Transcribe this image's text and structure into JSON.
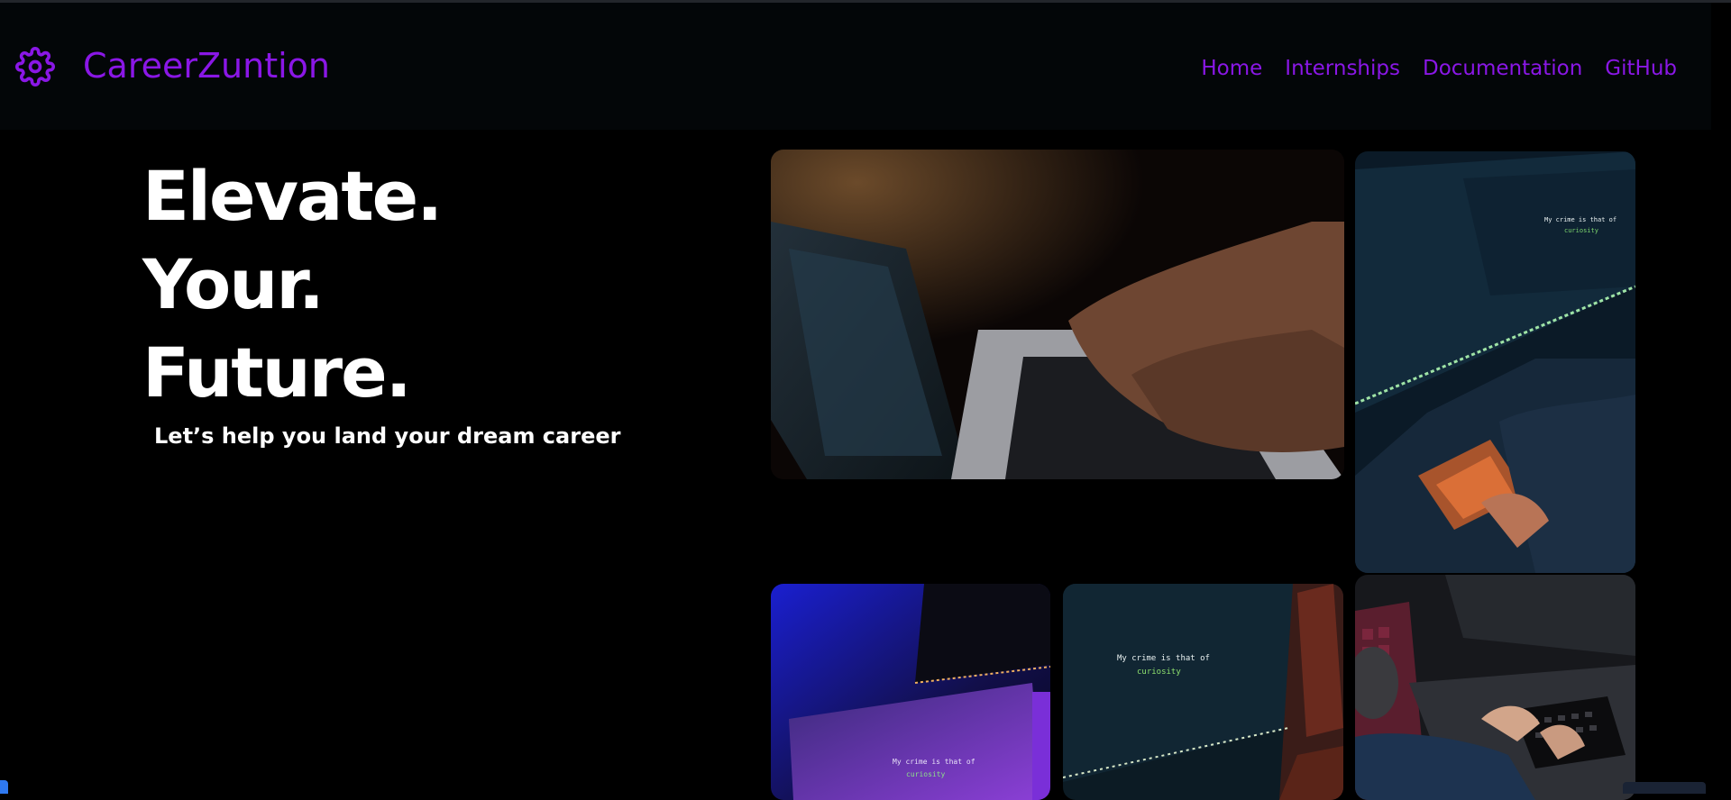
{
  "navbar": {
    "brand_icon": "gear-icon",
    "brand_name": "CareerZuntion",
    "links": [
      "Home",
      "Internships",
      "Documentation",
      "GitHub"
    ]
  },
  "hero": {
    "lines": [
      "Elevate.",
      "Your.",
      "Future."
    ],
    "subtitle": "Let’s help you land your dream career"
  },
  "gallery": {
    "screen_text_line1": "My crime is that of",
    "screen_text_line2": "curiosity"
  },
  "colors": {
    "accent": "#8a17e6",
    "background": "#000000",
    "navbar": "#030608",
    "text": "#ffffff"
  }
}
